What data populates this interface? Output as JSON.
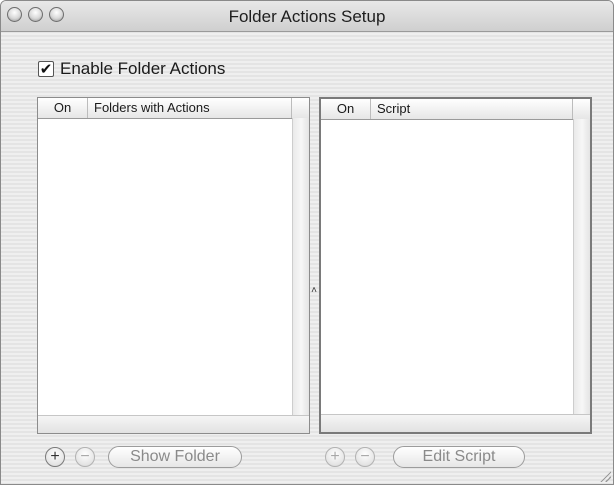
{
  "window": {
    "title": "Folder Actions Setup"
  },
  "enable_checkbox": {
    "label": "Enable Folder Actions",
    "checked": true,
    "mark": "✔"
  },
  "left_table": {
    "columns": [
      "On",
      "Folders with Actions"
    ],
    "rows": []
  },
  "right_table": {
    "columns": [
      "On",
      "Script"
    ],
    "rows": []
  },
  "left_buttons": {
    "add": "+",
    "remove": "−",
    "show_folder": "Show Folder"
  },
  "right_buttons": {
    "add": "+",
    "remove": "−",
    "edit_script": "Edit Script"
  },
  "splitter": {
    "glyph": "˄"
  }
}
